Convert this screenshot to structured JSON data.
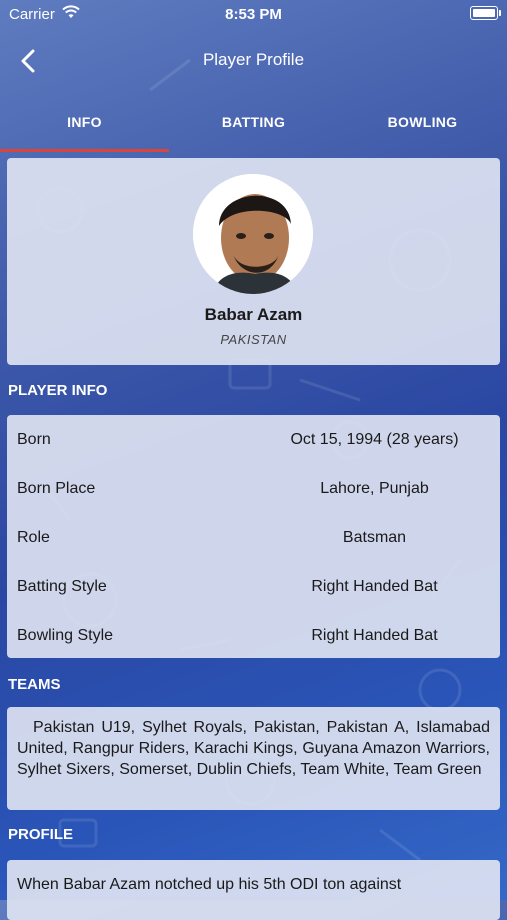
{
  "status_bar": {
    "carrier": "Carrier",
    "time": "8:53 PM"
  },
  "nav": {
    "title": "Player Profile"
  },
  "tabs": [
    {
      "label": "INFO",
      "active": true
    },
    {
      "label": "BATTING",
      "active": false
    },
    {
      "label": "BOWLING",
      "active": false
    }
  ],
  "player": {
    "name": "Babar Azam",
    "country": "PAKISTAN"
  },
  "sections": {
    "player_info": "PLAYER INFO",
    "teams": "TEAMS",
    "profile": "PROFILE"
  },
  "player_info": [
    {
      "label": "Born",
      "value": "Oct 15, 1994 (28 years)"
    },
    {
      "label": "Born Place",
      "value": "Lahore, Punjab"
    },
    {
      "label": "Role",
      "value": "Batsman"
    },
    {
      "label": "Batting Style",
      "value": "Right Handed Bat"
    },
    {
      "label": "Bowling Style",
      "value": "Right Handed Bat"
    }
  ],
  "teams": "Pakistan U19, Sylhet Royals, Pakistan, Pakistan A, Islamabad United, Rangpur Riders, Karachi Kings, Guyana Amazon Warriors, Sylhet Sixers, Somerset, Dublin Chiefs, Team White, Team Green",
  "profile_text": "When Babar Azam notched up his 5th ODI ton against",
  "colors": {
    "accent_underline": "#d9443b",
    "card_bg": "#e1e6f3"
  }
}
